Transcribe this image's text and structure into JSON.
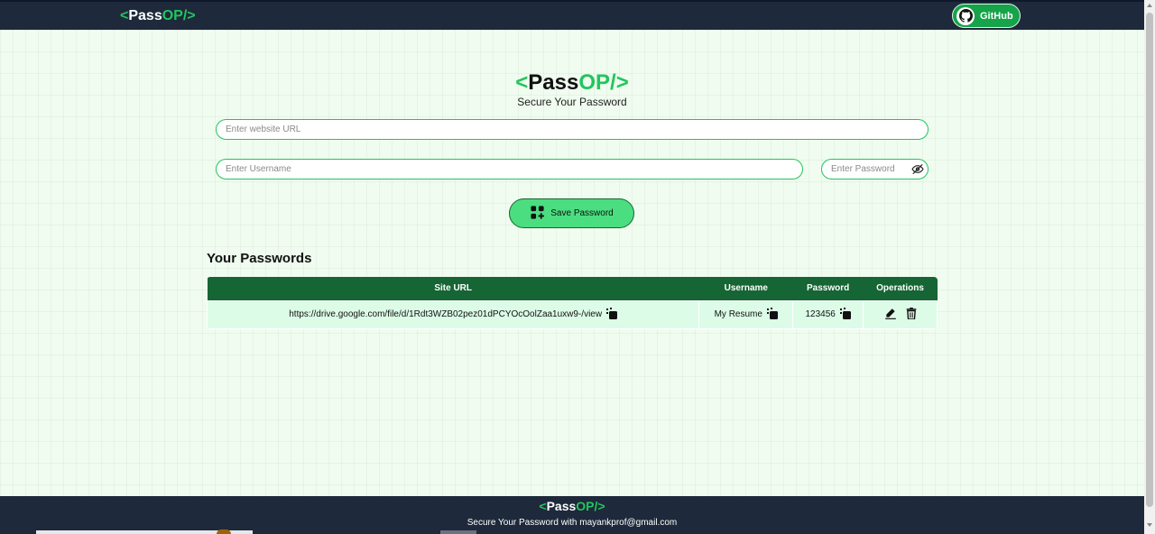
{
  "nav": {
    "logo": {
      "open": "<",
      "name": "Pass",
      "accent": "OP",
      "close": "/>"
    },
    "github_label": "GitHub"
  },
  "hero": {
    "logo": {
      "open": "<",
      "name": "Pass",
      "accent": "OP",
      "close": "/>"
    },
    "tagline": "Secure Your Password"
  },
  "form": {
    "url_placeholder": "Enter website URL",
    "username_placeholder": "Enter Username",
    "password_placeholder": "Enter Password",
    "save_label": "Save Password"
  },
  "passwords": {
    "title": "Your Passwords",
    "columns": [
      "Site URL",
      "Username",
      "Password",
      "Operations"
    ],
    "rows": [
      {
        "site": "https://drive.google.com/file/d/1Rdt3WZB02pez01dPCYOcOolZaa1uxw9-/view",
        "username": "My Resume",
        "password": "123456"
      }
    ]
  },
  "footer": {
    "logo": {
      "open": "<",
      "name": "Pass",
      "accent": "OP",
      "close": "/>"
    },
    "text": "Secure Your Password with mayankprof@gmail.com"
  },
  "colors": {
    "accent": "#22c55e",
    "dark": "#1e293b",
    "table_header": "#166534",
    "table_row": "#dcfce7",
    "button": "#4ade80"
  },
  "icons": [
    "github-icon",
    "eye-off-icon",
    "add-grid-icon",
    "copy-icon",
    "edit-icon",
    "delete-icon"
  ]
}
